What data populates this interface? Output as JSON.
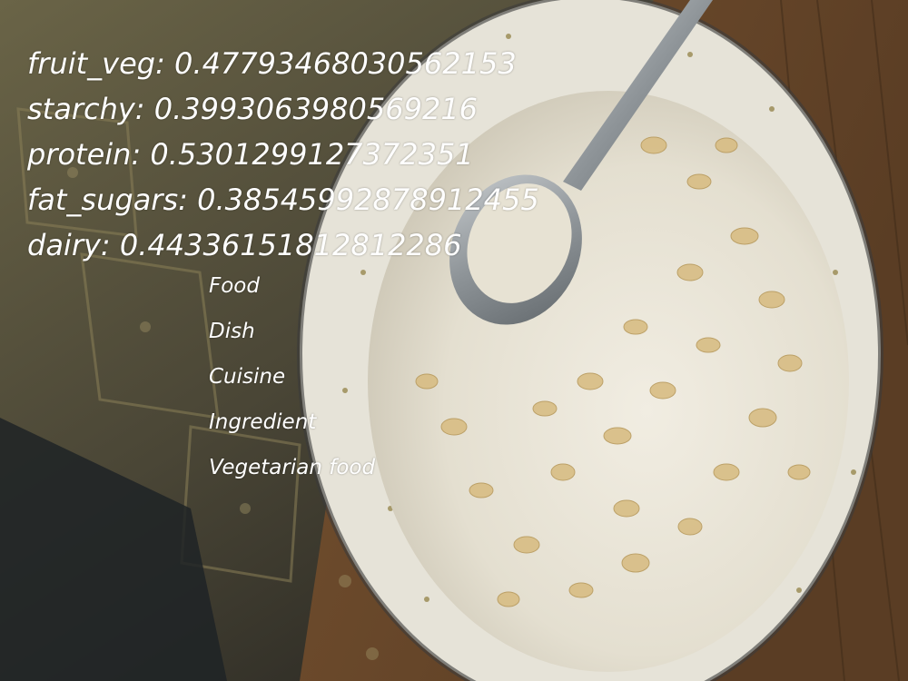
{
  "scores": [
    "fruit_veg: 0.47793468030562153",
    "starchy: 0.3993063980569216",
    "protein: 0.5301299127372351",
    "fat_sugars: 0.38545992878912455",
    "dairy: 0.44336151812812286"
  ],
  "labels": [
    "Food",
    "Dish",
    "Cuisine",
    "Ingredient",
    "Vegetarian food"
  ],
  "photo": {
    "subject": "bowl of oats in milk with a spoon",
    "colors": {
      "wood_table": "#6b4a2e",
      "tablecloth": "#5a5640",
      "bowl_rim": "#e8e6dc",
      "milk": "#e9e4d6",
      "oats": "#d9c08a",
      "spoon": "#9aa0a4"
    }
  }
}
